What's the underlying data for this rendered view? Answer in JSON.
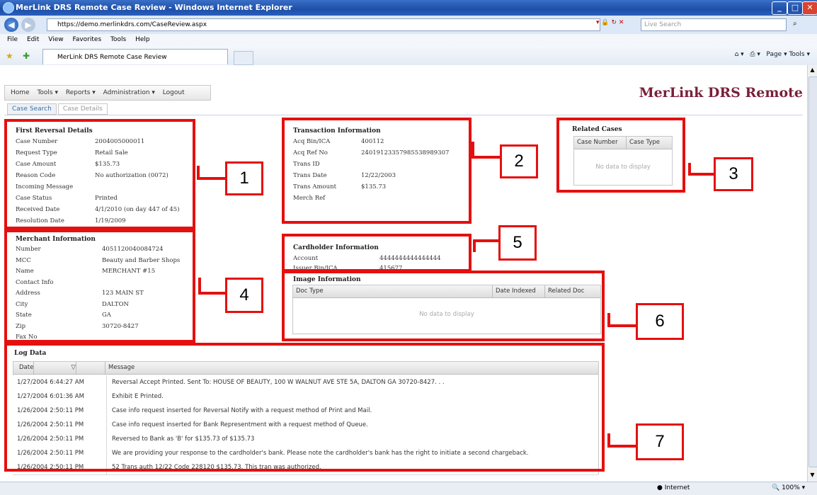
{
  "window": {
    "title": "MerLink DRS Remote Case Review - Windows Internet Explorer"
  },
  "browser": {
    "url": "https://demo.merlinkdrs.com/CaseReview.aspx",
    "search_placeholder": "Live Search",
    "menu": [
      "File",
      "Edit",
      "View",
      "Favorites",
      "Tools",
      "Help"
    ],
    "tab_title": "MerLink DRS Remote Case Review",
    "tools": "Page ▾  Tools ▾",
    "status_zone": "Internet",
    "zoom": "100%"
  },
  "app": {
    "brand": "MerLink DRS Remote",
    "menu": [
      "Home",
      "Tools ▾",
      "Reports ▾",
      "Administration ▾",
      "Logout"
    ],
    "tabs": [
      "Case Search",
      "Case Details"
    ]
  },
  "first_reversal": {
    "title": "First Reversal Details",
    "rows": [
      [
        "Case Number",
        "2004005000011"
      ],
      [
        "Request Type",
        "Retail Sale"
      ],
      [
        "Case Amount",
        "$135.73"
      ],
      [
        "Reason Code",
        "No authorization (0072)"
      ],
      [
        "Incoming Message",
        ""
      ],
      [
        "Case Status",
        "Printed"
      ],
      [
        "Received Date",
        "4/1/2010 (on day 447 of 45)"
      ],
      [
        "Resolution Date",
        "1/19/2009"
      ]
    ]
  },
  "transaction": {
    "title": "Transaction Information",
    "rows": [
      [
        "Acq Bin/ICA",
        "400112"
      ],
      [
        "Acq Ref No",
        "24019123357985538989307"
      ],
      [
        "Trans ID",
        ""
      ],
      [
        "Trans Date",
        "12/22/2003"
      ],
      [
        "Trans Amount",
        "$135.73"
      ],
      [
        "Merch Ref",
        ""
      ]
    ]
  },
  "related_cases": {
    "title": "Related Cases",
    "columns": [
      "Case Number",
      "Case Type"
    ],
    "empty": "No data to display"
  },
  "merchant": {
    "title": "Merchant Information",
    "rows": [
      [
        "Number",
        "4051120040084724"
      ],
      [
        "MCC",
        "Beauty and Barber Shops"
      ],
      [
        "Name",
        "MERCHANT #15"
      ],
      [
        "Contact Info",
        ""
      ],
      [
        "Address",
        "123 MAIN ST"
      ],
      [
        "City",
        "DALTON"
      ],
      [
        "State",
        "GA"
      ],
      [
        "Zip",
        "30720-8427"
      ],
      [
        "Fax No",
        ""
      ]
    ]
  },
  "cardholder": {
    "title": "Cardholder Information",
    "rows": [
      [
        "Account",
        "4444444444444444"
      ],
      [
        "Issuer Bin/ICA",
        "415677"
      ]
    ]
  },
  "image_info": {
    "title": "Image Information",
    "columns": [
      "Doc Type",
      "Date Indexed",
      "Related Doc"
    ],
    "empty": "No data to display"
  },
  "log": {
    "title": "Log Data",
    "columns": [
      "Date",
      "Message"
    ],
    "rows": [
      [
        "1/27/2004 6:44:27 AM",
        "Reversal Accept Printed. Sent To: HOUSE OF BEAUTY, 100 W WALNUT AVE STE 5A, DALTON GA 30720-8427. . ."
      ],
      [
        "1/27/2004 6:01:36 AM",
        "Exhibit E Printed."
      ],
      [
        "1/26/2004 2:50:11 PM",
        "Case info request inserted for Reversal Notify with a request method of Print and Mail."
      ],
      [
        "1/26/2004 2:50:11 PM",
        "Case info request inserted for Bank Representment with a request method of Queue."
      ],
      [
        "1/26/2004 2:50:11 PM",
        "Reversed to Bank as 'B' for $135.73 of $135.73"
      ],
      [
        "1/26/2004 2:50:11 PM",
        "We are providing your response to the cardholder's bank. Please note the cardholder's bank has the right to initiate a second chargeback."
      ],
      [
        "1/26/2004 2:50:11 PM",
        "52 Trans auth 12/22 Code 228120 $135.73. This tran was authorized."
      ]
    ]
  },
  "annotations": [
    "1",
    "2",
    "3",
    "4",
    "5",
    "6",
    "7"
  ],
  "colors": {
    "annotation": "#e4100f",
    "brand": "#7a1f3a",
    "titlebar": "#1e4fa8"
  }
}
